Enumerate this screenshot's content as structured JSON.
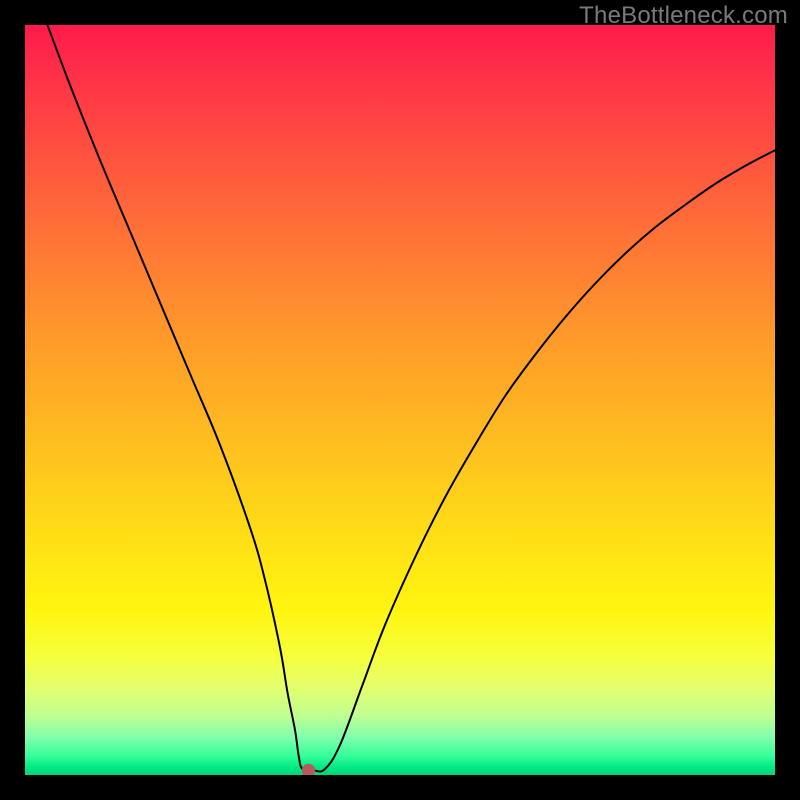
{
  "watermark": "TheBottleneck.com",
  "chart_data": {
    "type": "line",
    "title": "",
    "xlabel": "",
    "ylabel": "",
    "xlim": [
      0,
      100
    ],
    "ylim": [
      0,
      100
    ],
    "grid": false,
    "series": [
      {
        "name": "curve",
        "x": [
          3,
          6,
          10,
          14,
          18,
          22,
          26,
          30,
          32,
          34,
          35,
          36,
          36.5,
          37,
          38.5,
          40,
          42,
          45,
          48,
          52,
          56,
          60,
          64,
          68,
          72,
          76,
          80,
          84,
          88,
          92,
          96,
          100
        ],
        "values": [
          100,
          92,
          82,
          72.5,
          63,
          53.5,
          44,
          33,
          26,
          17,
          11,
          6,
          2.5,
          0.8,
          0.6,
          0.8,
          4,
          12,
          20,
          29,
          37,
          44,
          50.5,
          56,
          61,
          65.5,
          69.5,
          73,
          76,
          78.8,
          81.2,
          83.3
        ]
      }
    ],
    "marker": {
      "x": 37.8,
      "y": 0.6,
      "r": 0.9
    }
  }
}
